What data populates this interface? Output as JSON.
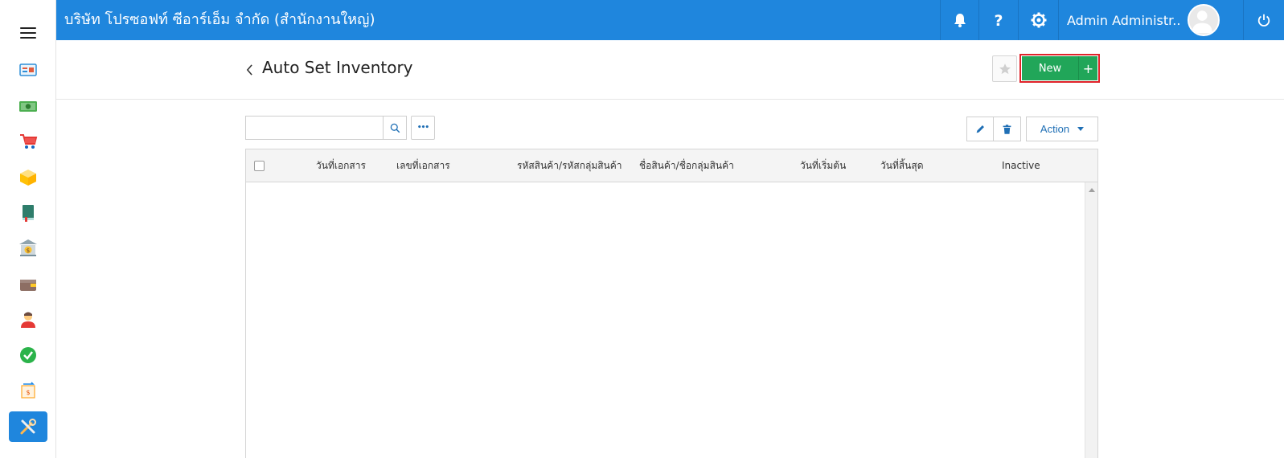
{
  "header": {
    "company": "บริษัท โปรซอฟท์ ซีอาร์เอ็ม จำกัด (สำนักงานใหญ่)",
    "user_name": "Admin Administr...",
    "icons": [
      "bell-icon",
      "help-icon",
      "settings-icon",
      "power-icon"
    ]
  },
  "sidebar": {
    "items": [
      {
        "icon": "dashboard-icon"
      },
      {
        "icon": "money-icon"
      },
      {
        "icon": "cart-icon"
      },
      {
        "icon": "box-icon"
      },
      {
        "icon": "book-icon"
      },
      {
        "icon": "bank-icon"
      },
      {
        "icon": "wallet-icon"
      },
      {
        "icon": "user-icon"
      },
      {
        "icon": "approve-icon"
      },
      {
        "icon": "transfer-icon"
      },
      {
        "icon": "tools-icon",
        "active": true
      }
    ]
  },
  "page": {
    "title": "Auto Set Inventory",
    "new_label": "New",
    "plus_label": "+"
  },
  "toolbar": {
    "search_value": "",
    "more_label": "•••",
    "action_label": "Action"
  },
  "grid": {
    "columns": [
      "วันที่เอกสาร",
      "เลขที่เอกสาร",
      "รหัสสินค้า/รหัสกลุ่มสินค้า",
      "ชื่อสินค้า/ชื่อกลุ่มสินค้า",
      "วันที่เริ่มต้น",
      "วันที่สิ้นสุด",
      "Inactive"
    ],
    "rows": []
  },
  "colors": {
    "primary": "#1f86dd",
    "new_button": "#21a659",
    "highlight_border": "#e0232a"
  }
}
